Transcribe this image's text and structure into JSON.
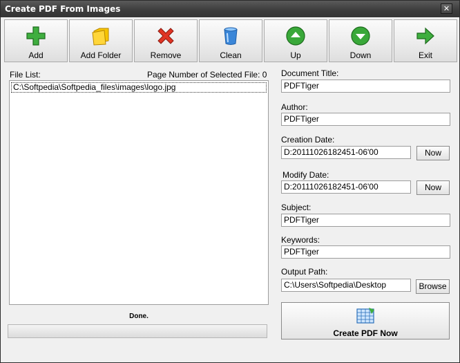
{
  "window": {
    "title": "Create PDF From Images",
    "close_glyph": "✕"
  },
  "toolbar": {
    "add": "Add",
    "add_folder": "Add Folder",
    "remove": "Remove",
    "clean": "Clean",
    "up": "Up",
    "down": "Down",
    "exit": "Exit"
  },
  "file_list": {
    "label": "File List:",
    "page_number_label": "Page Number of Selected File: 0",
    "items": [
      "C:\\Softpedia\\Softpedia_files\\images\\logo.jpg"
    ]
  },
  "status": {
    "text": "Done.",
    "progress": 0
  },
  "form": {
    "document_title_label": "Document Title:",
    "document_title_value": "PDFTiger",
    "author_label": "Author:",
    "author_value": "PDFTiger",
    "creation_date_label": "Creation Date:",
    "creation_date_value": "D:20111026182451-06'00",
    "modify_date_label": "Modify Date:",
    "modify_date_value": "D:20111026182451-06'00",
    "now_label": "Now",
    "subject_label": "Subject:",
    "subject_value": "PDFTiger",
    "keywords_label": "Keywords:",
    "keywords_value": "PDFTiger",
    "output_path_label": "Output Path:",
    "output_path_value": "C:\\Users\\Softpedia\\Desktop",
    "browse_label": "Browse",
    "create_label": "Create PDF Now"
  },
  "colors": {
    "green": "#2f9e2f",
    "red": "#d42a1e",
    "folder": "#f2b400",
    "clean_blue": "#3a86d8"
  }
}
